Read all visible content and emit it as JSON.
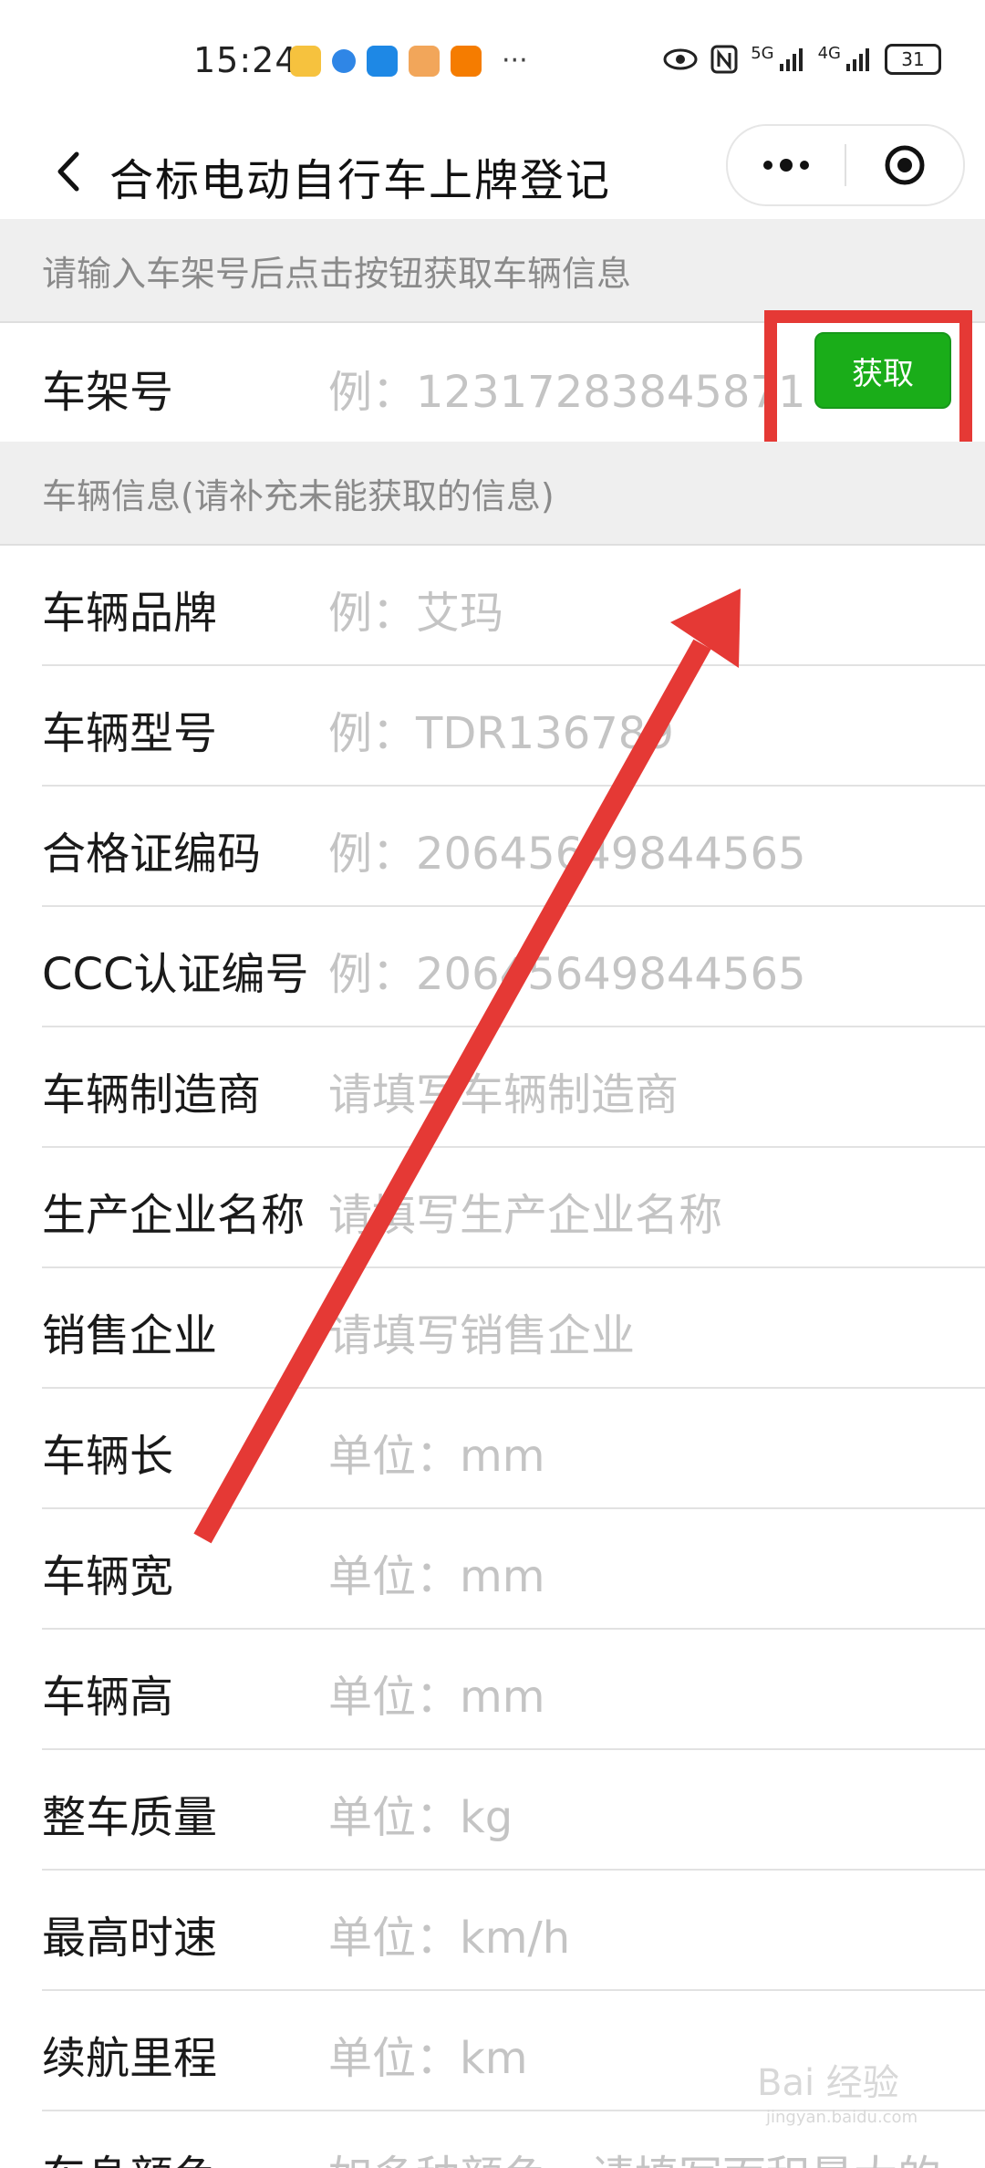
{
  "status_bar": {
    "time": "15:24",
    "more_indicator": "···",
    "network_5g": "5G",
    "network_4g": "4G",
    "battery_level": "31",
    "icons": [
      "weibo-icon",
      "app-icon-blue",
      "app-icon-cloud",
      "app-icon-tiger",
      "app-icon-orange",
      "eye-icon",
      "nfc-icon",
      "signal-5g-icon",
      "signal-4g-icon",
      "battery-icon"
    ]
  },
  "nav": {
    "title": "合标电动自行车上牌登记",
    "back_icon": "chevron-left-icon",
    "more_icon": "more-dots-icon",
    "close_icon": "target-icon"
  },
  "sections": {
    "frame_hint": "请输入车架号后点击按钮获取车辆信息",
    "vehicle_info": "车辆信息(请补充未能获取的信息)"
  },
  "frame_row": {
    "label": "车架号",
    "placeholder": "例：12317283845871",
    "button": "获取"
  },
  "rows": [
    {
      "label": "车辆品牌",
      "placeholder": "例：艾玛"
    },
    {
      "label": "车辆型号",
      "placeholder": "例：TDR136789"
    },
    {
      "label": "合格证编码",
      "placeholder": "例：20645649844565"
    },
    {
      "label": "CCC认证编号",
      "placeholder": "例：20645649844565"
    },
    {
      "label": "车辆制造商",
      "placeholder": "请填写车辆制造商"
    },
    {
      "label": "生产企业名称",
      "placeholder": "请填写生产企业名称"
    },
    {
      "label": "销售企业",
      "placeholder": "请填写销售企业"
    },
    {
      "label": "车辆长",
      "placeholder": "单位：mm"
    },
    {
      "label": "车辆宽",
      "placeholder": "单位：mm"
    },
    {
      "label": "车辆高",
      "placeholder": "单位：mm"
    },
    {
      "label": "整车质量",
      "placeholder": "单位：kg"
    },
    {
      "label": "最高时速",
      "placeholder": "单位：km/h"
    },
    {
      "label": "续航里程",
      "placeholder": "单位：km"
    },
    {
      "label": "车身颜色",
      "placeholder": "如多种颜色，请填写面积最大的"
    }
  ],
  "watermark": {
    "brand": "Bai 经验",
    "url": "jingyan.baidu.com"
  },
  "colors": {
    "button_green": "#1aad19",
    "annotation_red": "#e53935",
    "section_bg": "#efefef",
    "placeholder_gray": "#c4c4c4"
  }
}
